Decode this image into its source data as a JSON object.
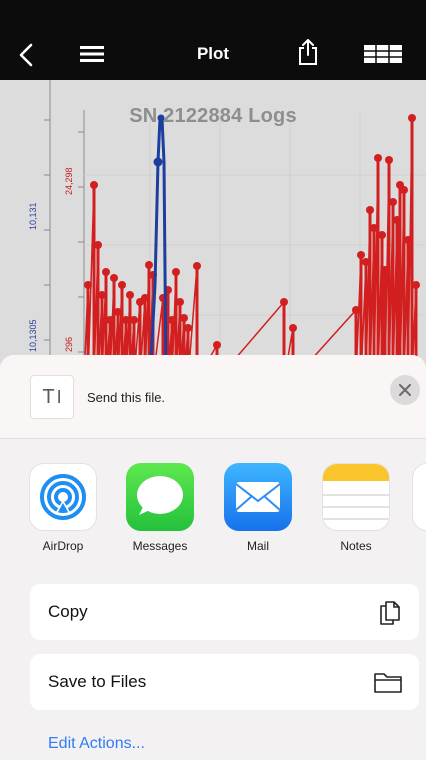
{
  "nav": {
    "title": "Plot",
    "icons": [
      "chevron-left-icon",
      "hamburger-menu-icon",
      "share-icon",
      "table-view-icon"
    ]
  },
  "chart_data": {
    "type": "line",
    "title": "SN 2122884 Logs",
    "axis_left_labels": [
      "10,131",
      "10,1305"
    ],
    "axis_right_labels": [
      "24,298",
      "296"
    ],
    "colors": {
      "series_red": "#d21f1f",
      "series_blue": "#1c3f9f"
    }
  },
  "share_sheet": {
    "message": "Send this file.",
    "thumb_glyph": "T",
    "apps": [
      {
        "label": "AirDrop",
        "icon": "airdrop-icon"
      },
      {
        "label": "Messages",
        "icon": "messages-icon"
      },
      {
        "label": "Mail",
        "icon": "mail-icon"
      },
      {
        "label": "Notes",
        "icon": "notes-icon"
      }
    ],
    "actions": [
      {
        "label": "Copy",
        "icon": "copy-icon"
      },
      {
        "label": "Save to Files",
        "icon": "folder-icon"
      }
    ],
    "edit_actions_label": "Edit Actions..."
  }
}
